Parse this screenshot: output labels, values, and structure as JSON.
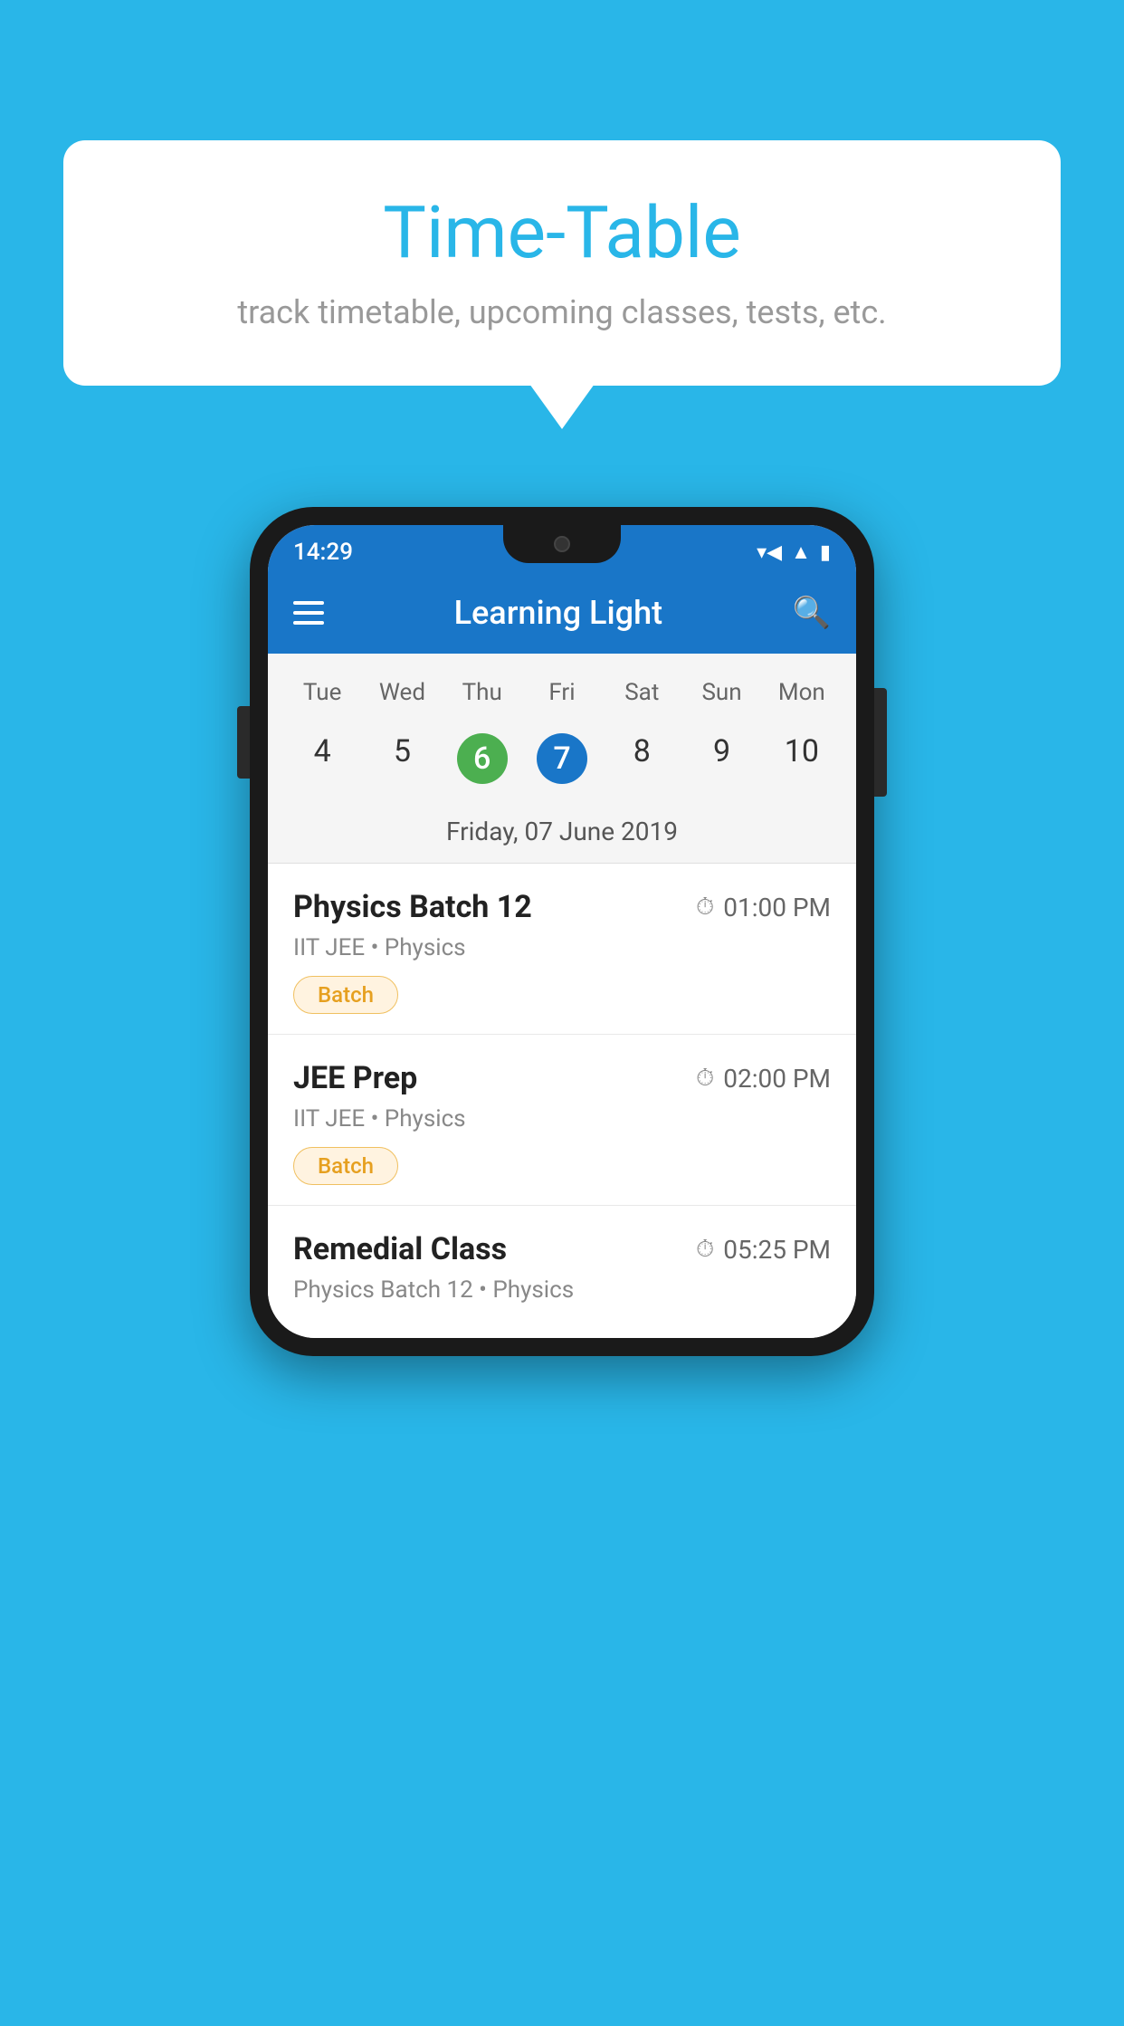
{
  "background_color": "#29b6e8",
  "speech_bubble": {
    "title": "Time-Table",
    "subtitle": "track timetable, upcoming classes, tests, etc."
  },
  "phone": {
    "status_bar": {
      "time": "14:29",
      "icons": [
        "wifi",
        "signal",
        "battery"
      ]
    },
    "app_bar": {
      "title": "Learning Light",
      "menu_icon": "hamburger",
      "search_icon": "search"
    },
    "calendar": {
      "day_names": [
        "Tue",
        "Wed",
        "Thu",
        "Fri",
        "Sat",
        "Sun",
        "Mon"
      ],
      "dates": [
        {
          "number": "4",
          "style": "normal"
        },
        {
          "number": "5",
          "style": "normal"
        },
        {
          "number": "6",
          "style": "green"
        },
        {
          "number": "7",
          "style": "blue"
        },
        {
          "number": "8",
          "style": "normal"
        },
        {
          "number": "9",
          "style": "normal"
        },
        {
          "number": "10",
          "style": "normal"
        }
      ],
      "selected_date_label": "Friday, 07 June 2019"
    },
    "schedule_items": [
      {
        "title": "Physics Batch 12",
        "time": "01:00 PM",
        "subtitle": "IIT JEE • Physics",
        "badge": "Batch"
      },
      {
        "title": "JEE Prep",
        "time": "02:00 PM",
        "subtitle": "IIT JEE • Physics",
        "badge": "Batch"
      },
      {
        "title": "Remedial Class",
        "time": "05:25 PM",
        "subtitle": "Physics Batch 12 • Physics",
        "badge": null
      }
    ]
  }
}
